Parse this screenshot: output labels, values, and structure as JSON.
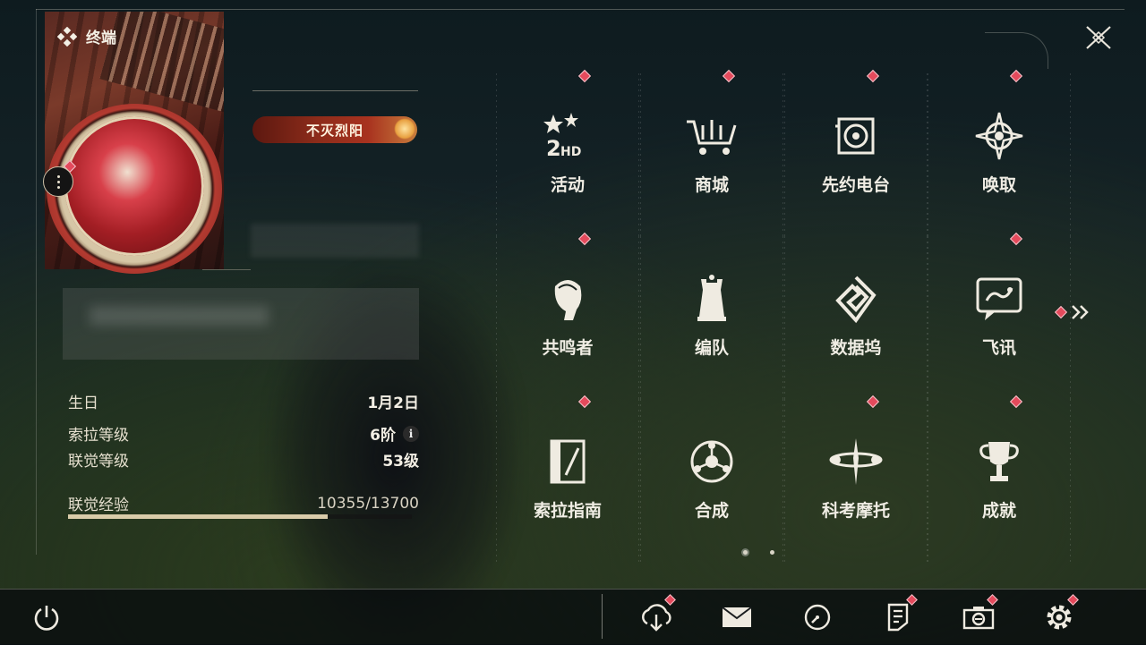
{
  "header": {
    "title": "终端"
  },
  "profile": {
    "badge_title": "不灭烈阳"
  },
  "stats": {
    "birthday_label": "生日",
    "birthday_value": "1月2日",
    "sol_level_label": "索拉等级",
    "sol_level_value": "6阶",
    "union_level_label": "联觉等级",
    "union_level_value": "53级",
    "union_exp_label": "联觉经验",
    "union_exp_value": "10355/13700",
    "union_exp_fraction": 0.7558
  },
  "menu": {
    "items": [
      {
        "label": "活动",
        "icon": "event-2nd-anniversary-icon",
        "notification": true
      },
      {
        "label": "商城",
        "icon": "shop-cart-icon",
        "notification": true
      },
      {
        "label": "先约电台",
        "icon": "radio-icon",
        "notification": true
      },
      {
        "label": "唤取",
        "icon": "convene-compass-icon",
        "notification": true
      },
      {
        "label": "共鸣者",
        "icon": "resonator-portrait-icon",
        "notification": true
      },
      {
        "label": "编队",
        "icon": "team-chess-icon",
        "notification": false
      },
      {
        "label": "数据坞",
        "icon": "data-bank-icon",
        "notification": false
      },
      {
        "label": "飞讯",
        "icon": "message-chat-icon",
        "notification": true
      },
      {
        "label": "索拉指南",
        "icon": "guidebook-icon",
        "notification": true
      },
      {
        "label": "合成",
        "icon": "synthesis-icon",
        "notification": false
      },
      {
        "label": "科考摩托",
        "icon": "motorcycle-icon",
        "notification": true
      },
      {
        "label": "成就",
        "icon": "trophy-icon",
        "notification": true
      }
    ],
    "page_current": 1,
    "page_total": 2
  },
  "bottom": {
    "buttons": [
      "power-icon",
      "download-icon",
      "mail-icon",
      "clock-icon",
      "notice-icon",
      "camera-icon",
      "settings-icon"
    ]
  },
  "colors": {
    "accent_red": "#e44a5c",
    "exp_bar": "#d9cba9",
    "text": "#f0ede4"
  }
}
